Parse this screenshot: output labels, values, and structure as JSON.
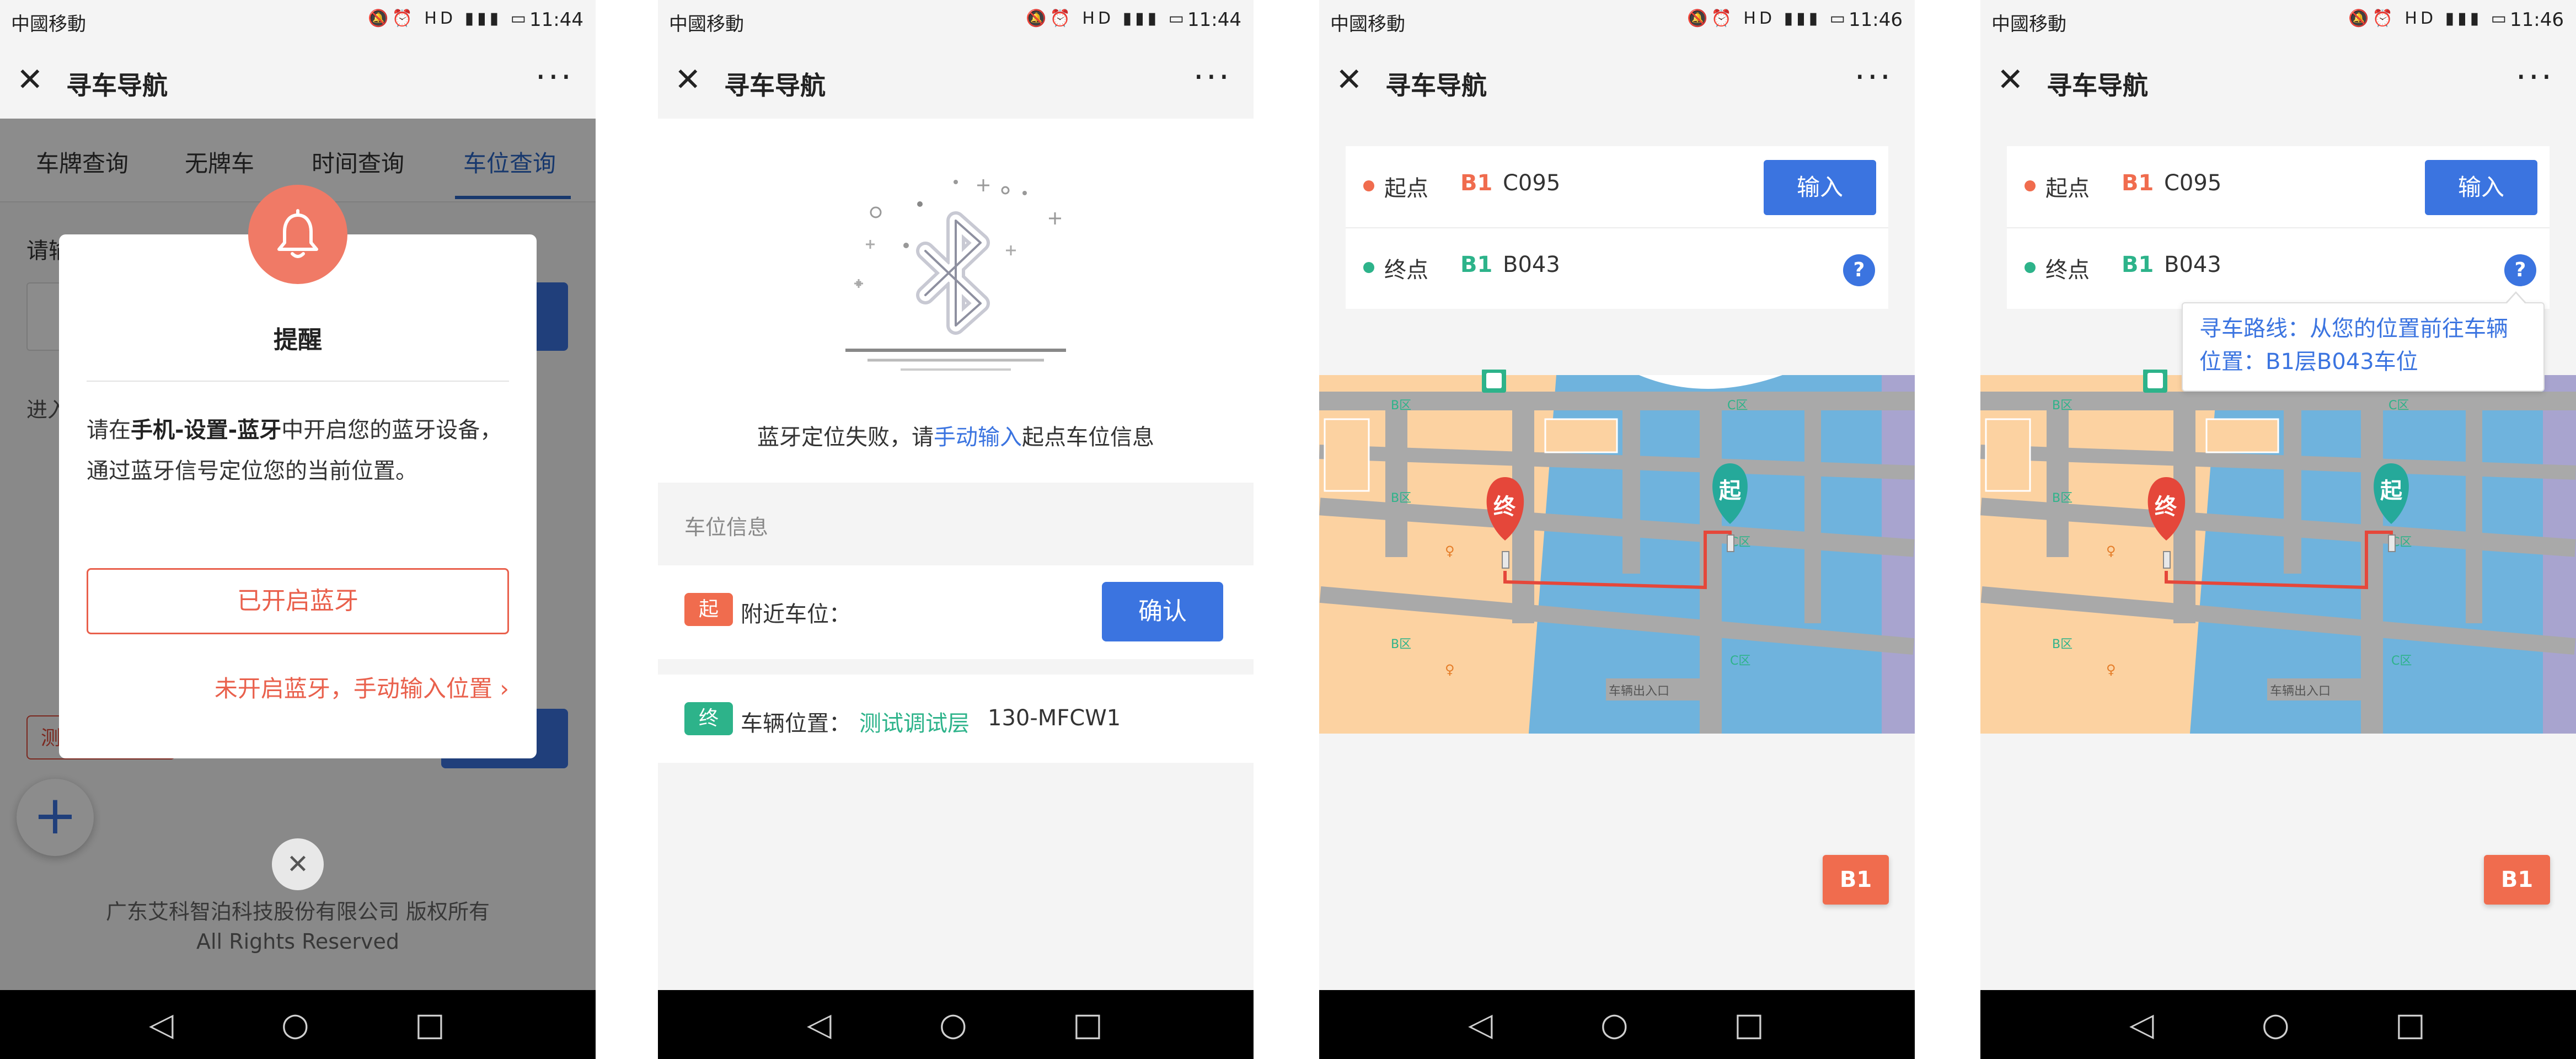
{
  "status": {
    "carrier": "中國移動",
    "time1": "11:44",
    "time2": "11:46"
  },
  "app": {
    "title": "寻车导航",
    "close_icon": "✕",
    "more": "···"
  },
  "screen1": {
    "tabs": [
      "车牌查询",
      "无牌车",
      "时间查询",
      "车位查询"
    ],
    "hint_text": "请输入您的车位编号",
    "section_text": "进入",
    "red_chip": "测",
    "fab_icon": "+",
    "copyright": "广东艾科智泊科技股份有限公司 版权所有",
    "rights": "All Rights Reserved",
    "dialog": {
      "title": "提醒",
      "text_pre": "请在",
      "text_bold": "手机-设置-蓝牙",
      "text_post": "中开启您的蓝牙设备，通过蓝牙信号定位您的当前位置。",
      "primary_button": "已开启蓝牙",
      "link": "未开启蓝牙，手动输入位置",
      "link_arrow": "›",
      "close_icon": "✕"
    }
  },
  "screen2": {
    "msg_pre": "蓝牙定位失败，请",
    "msg_link": "手动输入",
    "msg_post": "起点车位信息",
    "section": "车位信息",
    "start_badge": "起",
    "nearby_label": "附近车位：",
    "confirm": "确认",
    "end_badge": "终",
    "vehicle_label": "车辆位置：",
    "vehicle_floor": "测试调试层",
    "vehicle_plate": "130-MFCW1"
  },
  "nav": {
    "start_label": "起点",
    "start_floor": "B1",
    "start_slot": "C095",
    "input_button": "输入",
    "end_label": "终点",
    "end_floor": "B1",
    "end_slot": "B043",
    "help": "?",
    "tooltip": "寻车路线：从您的位置前往车辆位置：B1层B043车位",
    "floor_button": "B1",
    "map_labels": {
      "b_zone": "B区",
      "c_zone": "C区",
      "exit": "车辆出入口",
      "end_pin": "终",
      "start_pin": "起"
    }
  },
  "navbar": {
    "back": "◁",
    "home": "○",
    "recent": "□"
  },
  "colors": {
    "accent": "#3b74e0",
    "red": "#e9604c",
    "green": "#2db38a",
    "orange": "#f06c4e"
  }
}
